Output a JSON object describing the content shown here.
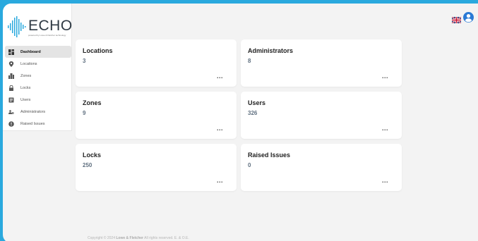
{
  "brand": {
    "name": "ECHO",
    "tagline": "powered by Lowe & Fletcher technology",
    "color": "#2aa9de"
  },
  "sidebar": {
    "items": [
      {
        "label": "Dashboard",
        "icon": "dashboard-icon",
        "active": true
      },
      {
        "label": "Locations",
        "icon": "location-pin-icon"
      },
      {
        "label": "Zones",
        "icon": "building-icon"
      },
      {
        "label": "Locks",
        "icon": "lock-icon"
      },
      {
        "label": "Users",
        "icon": "id-card-icon"
      },
      {
        "label": "Administrators",
        "icon": "users-gear-icon"
      },
      {
        "label": "Raised Issues",
        "icon": "alert-icon"
      }
    ]
  },
  "topbar": {
    "language_icon": "uk-flag-icon",
    "account_icon": "user-circle-icon"
  },
  "cards": [
    {
      "title": "Locations",
      "value": "3",
      "menu": "..."
    },
    {
      "title": "Administrators",
      "value": "8",
      "menu": "..."
    },
    {
      "title": "Zones",
      "value": "9",
      "menu": "..."
    },
    {
      "title": "Users",
      "value": "326",
      "menu": "..."
    },
    {
      "title": "Locks",
      "value": "250",
      "menu": "..."
    },
    {
      "title": "Raised Issues",
      "value": "0",
      "menu": "..."
    }
  ],
  "footer": {
    "prefix": "Copyright © 2024",
    "company": "Lowe & Fletcher",
    "suffix": "All rights reserved. E. & O.E."
  }
}
